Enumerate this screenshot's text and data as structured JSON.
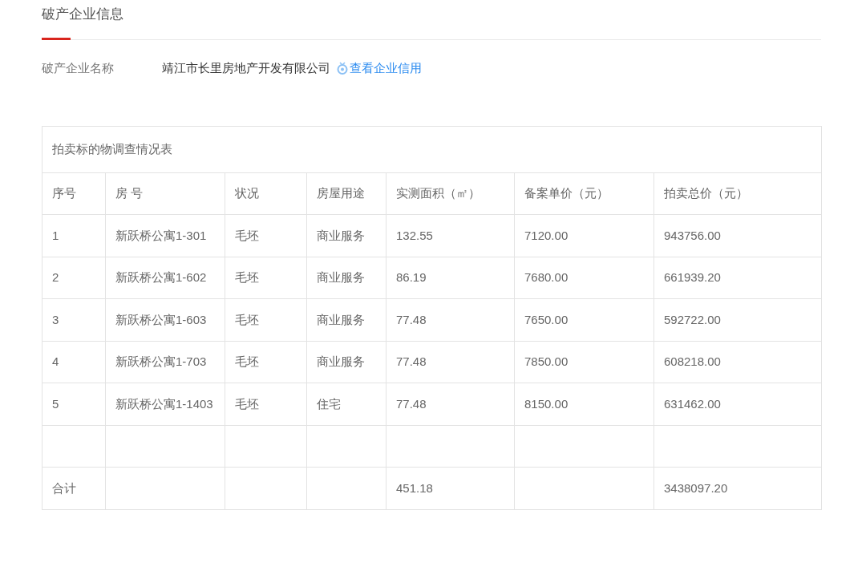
{
  "section": {
    "title": "破产企业信息"
  },
  "company": {
    "label": "破产企业名称",
    "name": "靖江市长里房地产开发有限公司",
    "credit_link": "查看企业信用"
  },
  "table": {
    "caption": "拍卖标的物调查情况表",
    "columns": [
      "序号",
      "房 号",
      "状况",
      "房屋用途",
      "实测面积（㎡）",
      "备案单价（元）",
      "拍卖总价（元）"
    ],
    "rows": [
      {
        "kind": "data",
        "cells": [
          "1",
          "新跃桥公寓1-301",
          "毛坯",
          "商业服务",
          "132.55",
          "7120.00",
          "943756.00"
        ]
      },
      {
        "kind": "data",
        "cells": [
          "2",
          "新跃桥公寓1-602",
          "毛坯",
          "商业服务",
          "86.19",
          "7680.00",
          "661939.20"
        ]
      },
      {
        "kind": "data",
        "cells": [
          "3",
          "新跃桥公寓1-603",
          "毛坯",
          "商业服务",
          "77.48",
          "7650.00",
          "592722.00"
        ]
      },
      {
        "kind": "data",
        "cells": [
          "4",
          "新跃桥公寓1-703",
          "毛坯",
          "商业服务",
          "77.48",
          "7850.00",
          "608218.00"
        ]
      },
      {
        "kind": "data",
        "cells": [
          "5",
          "新跃桥公寓1-1403",
          "毛坯",
          "住宅",
          "77.48",
          "8150.00",
          "631462.00"
        ]
      },
      {
        "kind": "blank",
        "cells": []
      },
      {
        "kind": "total",
        "cells": [
          "合计",
          "",
          "",
          "",
          "451.18",
          "",
          "3438097.20"
        ]
      }
    ]
  }
}
